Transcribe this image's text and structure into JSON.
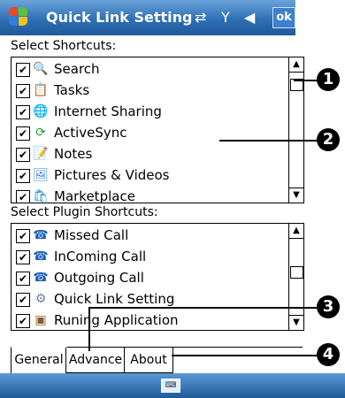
{
  "titlebar": {
    "title": "Quick Link Setting",
    "ok_label": "ok",
    "icons": [
      "windows-logo",
      "connectivity",
      "signal-off",
      "volume"
    ]
  },
  "shortcuts": {
    "label": "Select Shortcuts:",
    "items": [
      {
        "label": "Search",
        "checked": true,
        "icon": "search-icon"
      },
      {
        "label": "Tasks",
        "checked": true,
        "icon": "tasks-icon"
      },
      {
        "label": "Internet Sharing",
        "checked": true,
        "icon": "internet-sharing-icon"
      },
      {
        "label": "ActiveSync",
        "checked": true,
        "icon": "activesync-icon"
      },
      {
        "label": "Notes",
        "checked": true,
        "icon": "notes-icon"
      },
      {
        "label": "Pictures & Videos",
        "checked": true,
        "icon": "pictures-icon"
      },
      {
        "label": "Marketplace",
        "checked": true,
        "icon": "marketplace-icon"
      }
    ]
  },
  "plugins": {
    "label": "Select Plugin Shortcuts:",
    "items": [
      {
        "label": "Missed Call",
        "checked": true,
        "icon": "missed-call-icon"
      },
      {
        "label": "InComing Call",
        "checked": true,
        "icon": "incoming-call-icon"
      },
      {
        "label": "Outgoing Call",
        "checked": true,
        "icon": "outgoing-call-icon"
      },
      {
        "label": "Quick Link Setting",
        "checked": true,
        "icon": "quick-link-icon"
      },
      {
        "label": "Runing Application",
        "checked": true,
        "icon": "running-app-icon"
      }
    ]
  },
  "tabs": [
    "General",
    "Advance",
    "About"
  ],
  "active_tab": "General",
  "callouts": [
    "1",
    "2",
    "3",
    "4"
  ]
}
